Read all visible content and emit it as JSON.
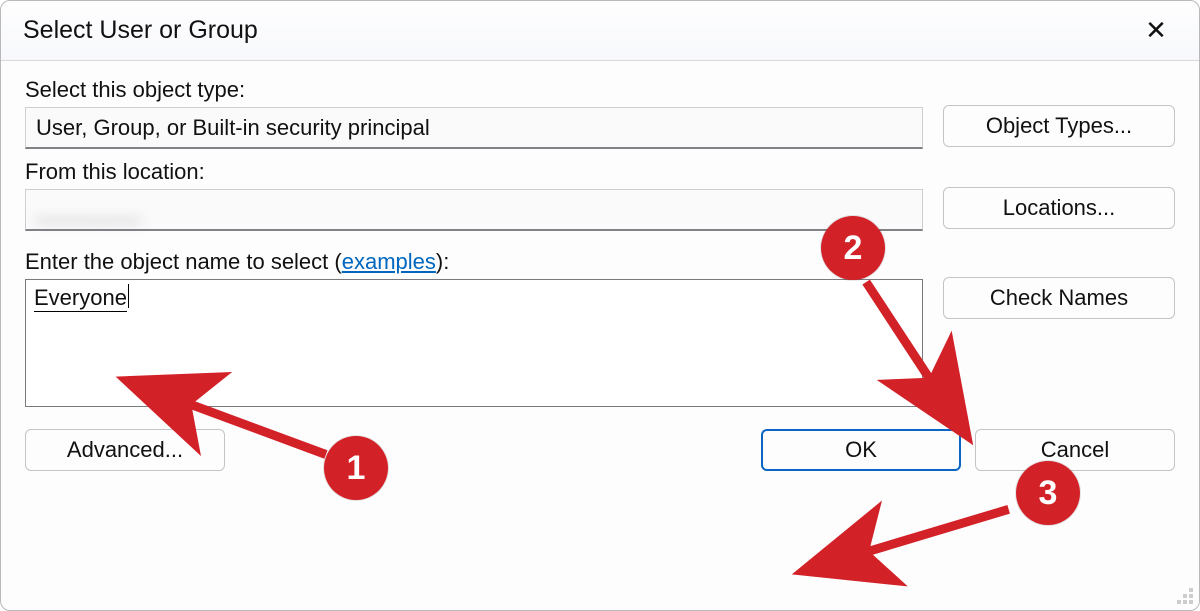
{
  "title": "Select User or Group",
  "close_glyph": "✕",
  "labels": {
    "object_type": "Select this object type:",
    "from_location": "From this location:",
    "enter_name_prefix": "Enter the object name to select (",
    "examples_link": "examples",
    "enter_name_suffix": "):"
  },
  "fields": {
    "object_type_value": "User, Group, or Built-in security principal",
    "location_value": "________",
    "entered_name": "Everyone"
  },
  "buttons": {
    "object_types": "Object Types...",
    "locations": "Locations...",
    "check_names": "Check Names",
    "advanced": "Advanced...",
    "ok": "OK",
    "cancel": "Cancel"
  },
  "annotations": {
    "one": "1",
    "two": "2",
    "three": "3"
  }
}
